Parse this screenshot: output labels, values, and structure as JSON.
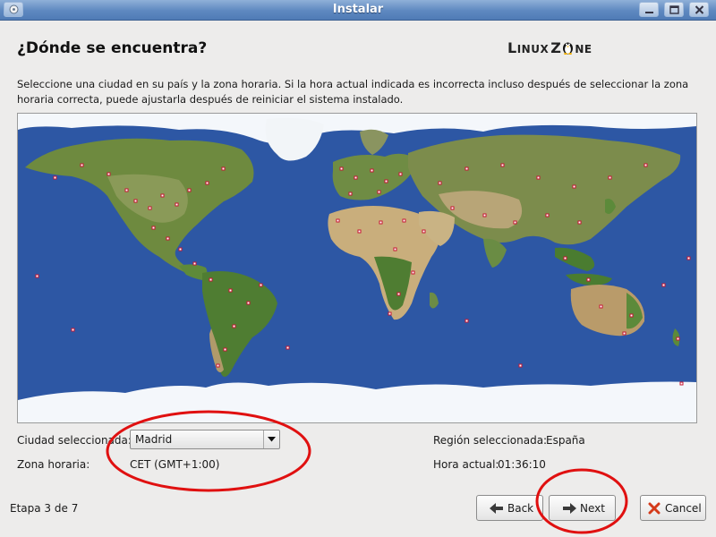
{
  "window": {
    "title": "Instalar",
    "app_icon": "installer-disc-icon",
    "controls": [
      "minimize-icon",
      "maximize-icon",
      "close-icon"
    ]
  },
  "page": {
    "heading": "¿Dónde se encuentra?",
    "logo_text": {
      "l": "L",
      "inux": "INUX",
      "z": "Z",
      "ne": "NE"
    },
    "intro": "Seleccione una ciudad en su país y la zona horaria. Si la hora actual indicada es incorrecta incluso después de seleccionar la zona horaria correcta, puede ajustarla después de reiniciar el sistema instalado."
  },
  "map": {
    "ocean_color": "#2d57a4",
    "marker_color": "#c81432"
  },
  "form": {
    "city_label": "Ciudad seleccionada:",
    "city_value": "Madrid",
    "timezone_label": "Zona horaria:",
    "timezone_value": "CET (GMT+1:00)",
    "region_label": "Región seleccionada:",
    "region_value": "España",
    "time_label": "Hora actual:",
    "time_value": "01:36:10"
  },
  "footer": {
    "step": "Etapa 3 de 7",
    "back_label": "Back",
    "next_label": "Next",
    "cancel_label": "Cancel"
  },
  "annotation_color": "#e01010"
}
